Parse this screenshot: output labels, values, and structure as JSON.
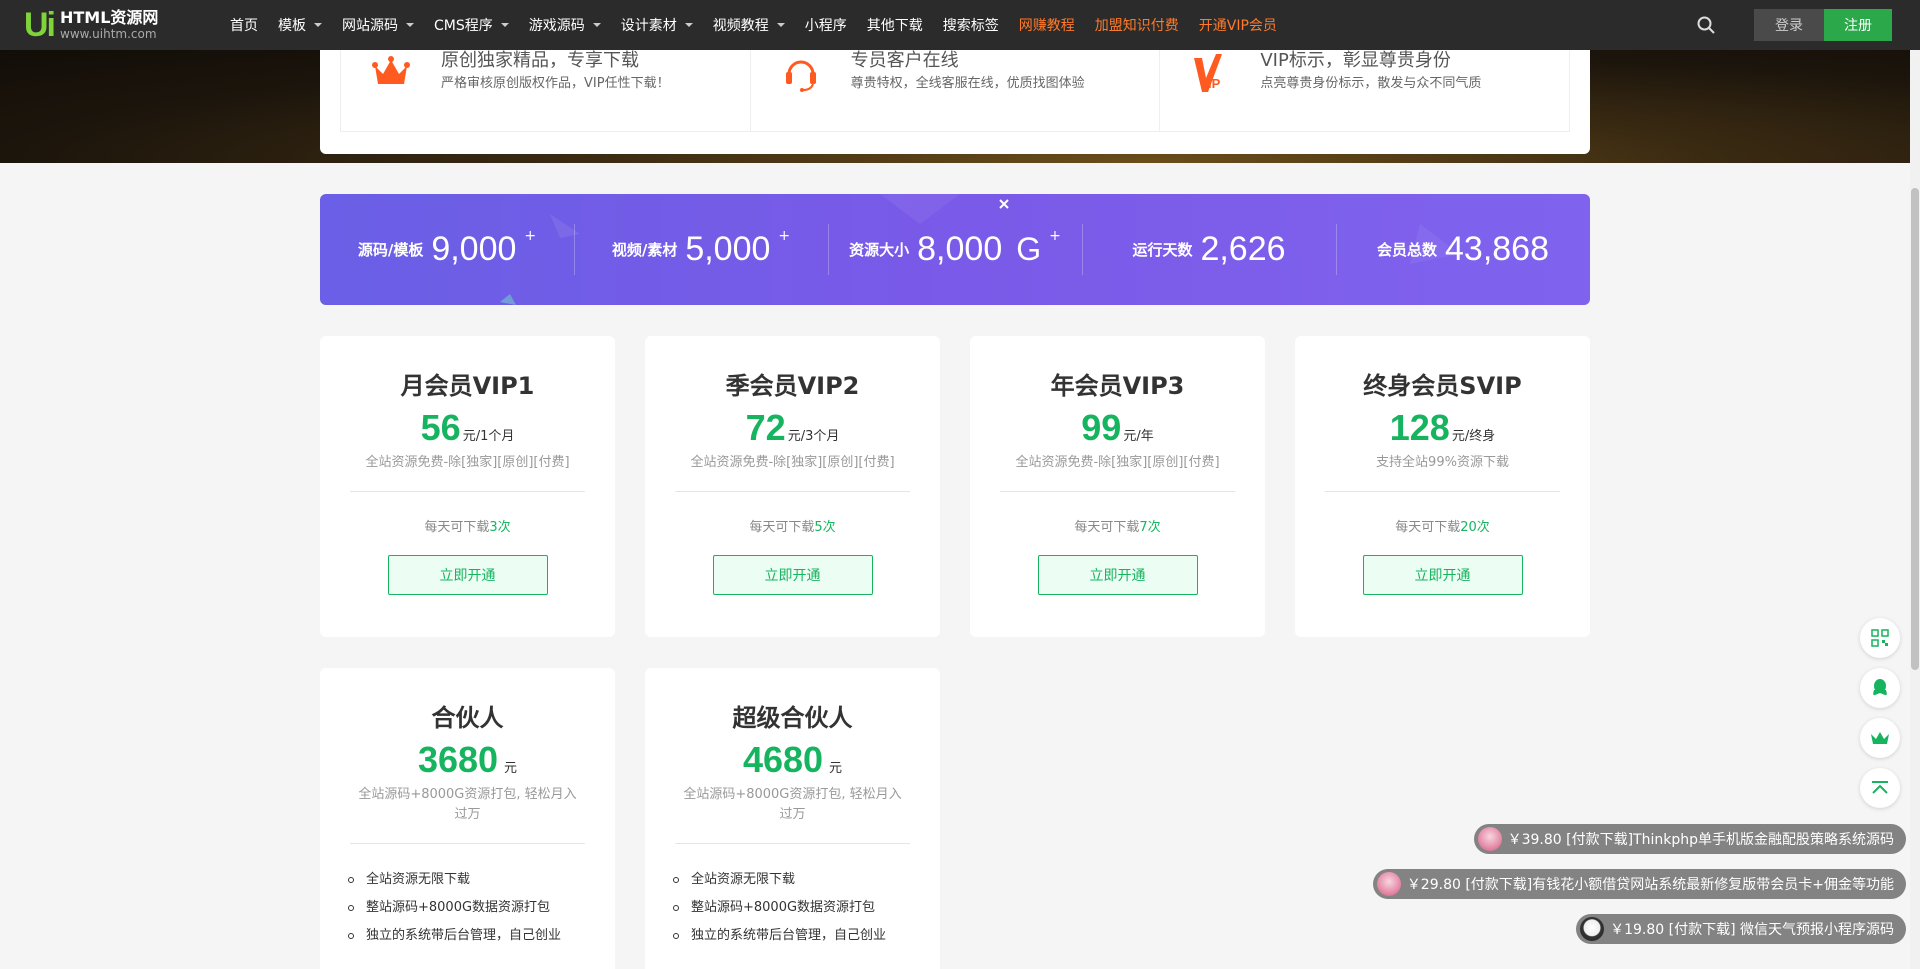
{
  "brand": {
    "mark": "Ui",
    "name": "HTML资源网",
    "url": "www.uihtm.com",
    "color": "#7fd43a"
  },
  "nav": {
    "items": [
      {
        "label": "首页",
        "dropdown": false,
        "highlight": false
      },
      {
        "label": "模板",
        "dropdown": true,
        "highlight": false
      },
      {
        "label": "网站源码",
        "dropdown": true,
        "highlight": false
      },
      {
        "label": "CMS程序",
        "dropdown": true,
        "highlight": false
      },
      {
        "label": "游戏源码",
        "dropdown": true,
        "highlight": false
      },
      {
        "label": "设计素材",
        "dropdown": true,
        "highlight": false
      },
      {
        "label": "视频教程",
        "dropdown": true,
        "highlight": false
      },
      {
        "label": "小程序",
        "dropdown": false,
        "highlight": false
      },
      {
        "label": "其他下载",
        "dropdown": false,
        "highlight": false
      },
      {
        "label": "搜索标签",
        "dropdown": false,
        "highlight": false
      },
      {
        "label": "网赚教程",
        "dropdown": false,
        "highlight": true
      },
      {
        "label": "加盟知识付费",
        "dropdown": false,
        "highlight": true
      },
      {
        "label": "开通VIP会员",
        "dropdown": false,
        "highlight": true
      }
    ],
    "search_icon": "search-icon",
    "login": "登录",
    "register": "注册"
  },
  "features": [
    {
      "icon": "crown-icon",
      "title": "原创独家精品，专享下载",
      "desc": "严格审核原创版权作品，VIP任性下载！"
    },
    {
      "icon": "headset-icon",
      "title": "专员客户在线",
      "desc": "尊贵特权，全线客服在线，优质找图体验"
    },
    {
      "icon": "vip-icon",
      "title": "VIP标示，彰显尊贵身份",
      "desc": "点亮尊贵身份标示，散发与众不同气质"
    }
  ],
  "stats": [
    {
      "label": "源码/模板",
      "value": "9,000",
      "unit": "",
      "plus": "+"
    },
    {
      "label": "视频/素材",
      "value": "5,000",
      "unit": "",
      "plus": "+"
    },
    {
      "label": "资源大小",
      "value": "8,000",
      "unit": "G",
      "plus": "+"
    },
    {
      "label": "运行天数",
      "value": "2,626",
      "unit": "",
      "plus": ""
    },
    {
      "label": "会员总数",
      "value": "43,868",
      "unit": "",
      "plus": ""
    }
  ],
  "plans": [
    {
      "title": "月会员VIP1",
      "price": "56",
      "unit": "元/1个月",
      "desc": "全站资源免费-除[独家][原创][付费]",
      "daily_prefix": "每天可下载",
      "daily_count": "3次",
      "button": "立即开通"
    },
    {
      "title": "季会员VIP2",
      "price": "72",
      "unit": "元/3个月",
      "desc": "全站资源免费-除[独家][原创][付费]",
      "daily_prefix": "每天可下载",
      "daily_count": "5次",
      "button": "立即开通"
    },
    {
      "title": "年会员VIP3",
      "price": "99",
      "unit": "元/年",
      "desc": "全站资源免费-除[独家][原创][付费]",
      "daily_prefix": "每天可下载",
      "daily_count": "7次",
      "button": "立即开通"
    },
    {
      "title": "终身会员SVIP",
      "price": "128",
      "unit": "元/终身",
      "desc": "支持全站99%资源下载",
      "daily_prefix": "每天可下载",
      "daily_count": "20次",
      "button": "立即开通"
    }
  ],
  "partners": [
    {
      "title": "合伙人",
      "price": "3680",
      "unit": "元",
      "desc": "全站源码+8000G资源打包, 轻松月入过万",
      "features": [
        "全站资源无限下载",
        "整站源码+8000G数据资源打包",
        "独立的系统带后台管理，自己创业"
      ]
    },
    {
      "title": "超级合伙人",
      "price": "4680",
      "unit": "元",
      "desc": "全站源码+8000G资源打包, 轻松月入过万",
      "features": [
        "全站资源无限下载",
        "整站源码+8000G数据资源打包",
        "独立的系统带后台管理，自己创业"
      ]
    }
  ],
  "tools": [
    "qrcode-icon",
    "qq-icon",
    "crown-icon",
    "back-to-top-icon"
  ],
  "notifications": [
    {
      "text": "￥39.80 [付款下载]Thinkphp单手机版金融配股策略系统源码"
    },
    {
      "text": "￥29.80 [付款下载]有钱花小额借贷网站系统最新修复版带会员卡+佣金等功能"
    },
    {
      "text": "￥19.80 [付款下载] 微信天气预报小程序源码"
    }
  ],
  "colors": {
    "green": "#17b45f",
    "orange": "#ff7a2a",
    "purple": "#7a5ae8",
    "nav_bg": "#2b2b2b"
  }
}
